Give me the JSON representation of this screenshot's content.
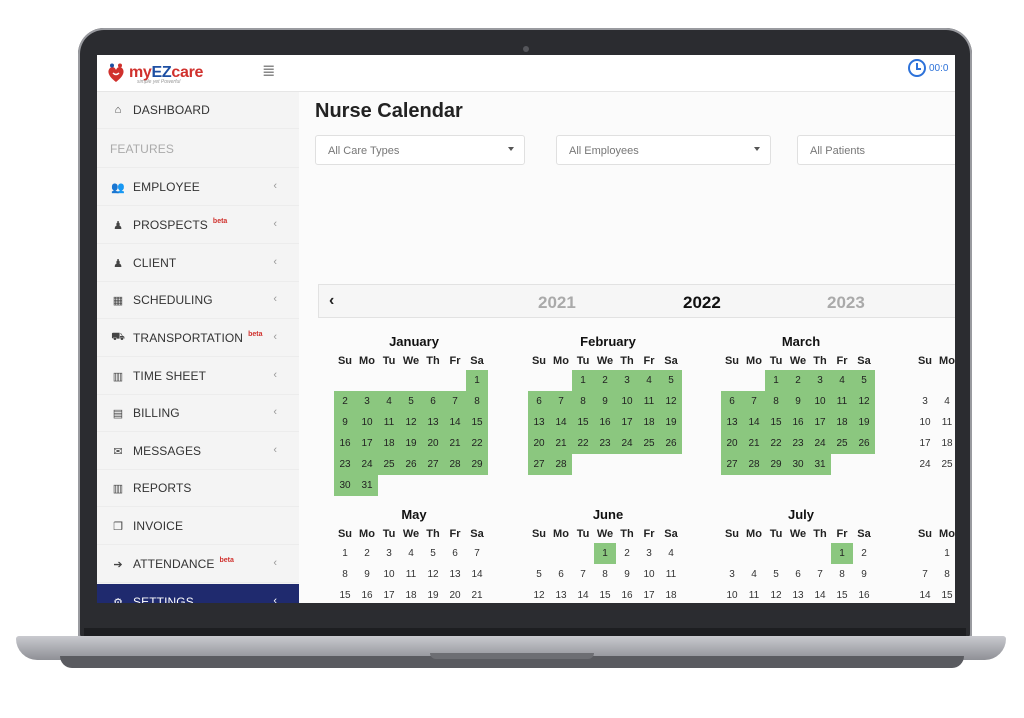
{
  "app": {
    "logo": {
      "my": "my",
      "ez": "EZ",
      "care": "care",
      "tagline": "simple yet Powerful"
    },
    "clock_text": "00:0"
  },
  "sidebar": {
    "items": [
      {
        "label": "DASHBOARD",
        "icon": "home-icon",
        "chevron": false,
        "beta": false
      },
      {
        "label": "FEATURES",
        "icon": "",
        "chevron": false,
        "beta": false,
        "section": true
      },
      {
        "label": "EMPLOYEE",
        "icon": "users-icon",
        "chevron": true,
        "beta": false
      },
      {
        "label": "PROSPECTS",
        "icon": "user-icon",
        "chevron": true,
        "beta": true
      },
      {
        "label": "CLIENT",
        "icon": "user-icon",
        "chevron": true,
        "beta": false
      },
      {
        "label": "SCHEDULING",
        "icon": "calendar-icon",
        "chevron": true,
        "beta": false
      },
      {
        "label": "TRANSPORTATION",
        "icon": "truck-icon",
        "chevron": true,
        "beta": true
      },
      {
        "label": "TIME SHEET",
        "icon": "bar-chart-icon",
        "chevron": true,
        "beta": false
      },
      {
        "label": "BILLING",
        "icon": "file-icon",
        "chevron": true,
        "beta": false
      },
      {
        "label": "MESSAGES",
        "icon": "envelope-icon",
        "chevron": true,
        "beta": false
      },
      {
        "label": "REPORTS",
        "icon": "bar-chart-icon",
        "chevron": false,
        "beta": false
      },
      {
        "label": "INVOICE",
        "icon": "copy-icon",
        "chevron": false,
        "beta": false
      },
      {
        "label": "ATTENDANCE",
        "icon": "sign-in-icon",
        "chevron": true,
        "beta": true
      },
      {
        "label": "SETTINGS",
        "icon": "gear-icon",
        "chevron": true,
        "beta": false,
        "active": true
      }
    ],
    "beta_label": "beta"
  },
  "main": {
    "title": "Nurse Calendar",
    "filters": [
      {
        "label": "All Care Types"
      },
      {
        "label": "All Employees"
      },
      {
        "label": "All Patients"
      }
    ],
    "year_nav": {
      "prev_symbol": "‹",
      "years": [
        "2021",
        "2022",
        "2023"
      ],
      "current": "2022"
    },
    "weekdays": [
      "Su",
      "Mo",
      "Tu",
      "We",
      "Th",
      "Fr",
      "Sa"
    ],
    "months": [
      {
        "name": "January",
        "first_weekday": 6,
        "days": 31,
        "highlighted": [
          1,
          2,
          3,
          4,
          5,
          6,
          7,
          8,
          9,
          10,
          11,
          12,
          13,
          14,
          15,
          16,
          17,
          18,
          19,
          20,
          21,
          22,
          23,
          24,
          25,
          26,
          27,
          28,
          29,
          30,
          31
        ]
      },
      {
        "name": "February",
        "first_weekday": 2,
        "days": 28,
        "highlighted": [
          1,
          2,
          3,
          4,
          5,
          6,
          7,
          8,
          9,
          10,
          11,
          12,
          13,
          14,
          15,
          16,
          17,
          18,
          19,
          20,
          21,
          22,
          23,
          24,
          25,
          26,
          27,
          28
        ]
      },
      {
        "name": "March",
        "first_weekday": 2,
        "days": 31,
        "highlighted": [
          1,
          2,
          3,
          4,
          5,
          6,
          7,
          8,
          9,
          10,
          11,
          12,
          13,
          14,
          15,
          16,
          17,
          18,
          19,
          20,
          21,
          22,
          23,
          24,
          25,
          26,
          27,
          28,
          29,
          30,
          31
        ]
      },
      {
        "name": "",
        "first_weekday": 5,
        "days": 30,
        "highlighted": []
      },
      {
        "name": "May",
        "first_weekday": 0,
        "days": 31,
        "highlighted": []
      },
      {
        "name": "June",
        "first_weekday": 3,
        "days": 30,
        "highlighted": [
          1
        ]
      },
      {
        "name": "July",
        "first_weekday": 5,
        "days": 31,
        "highlighted": [
          1
        ]
      },
      {
        "name": "",
        "first_weekday": 1,
        "days": 31,
        "highlighted": []
      }
    ]
  },
  "colors": {
    "highlight": "#8bc77f",
    "sidebar_active": "#1f2a6e",
    "accent": "#2d72d9",
    "brand_red": "#d0312d",
    "brand_blue": "#1d4fa3"
  }
}
